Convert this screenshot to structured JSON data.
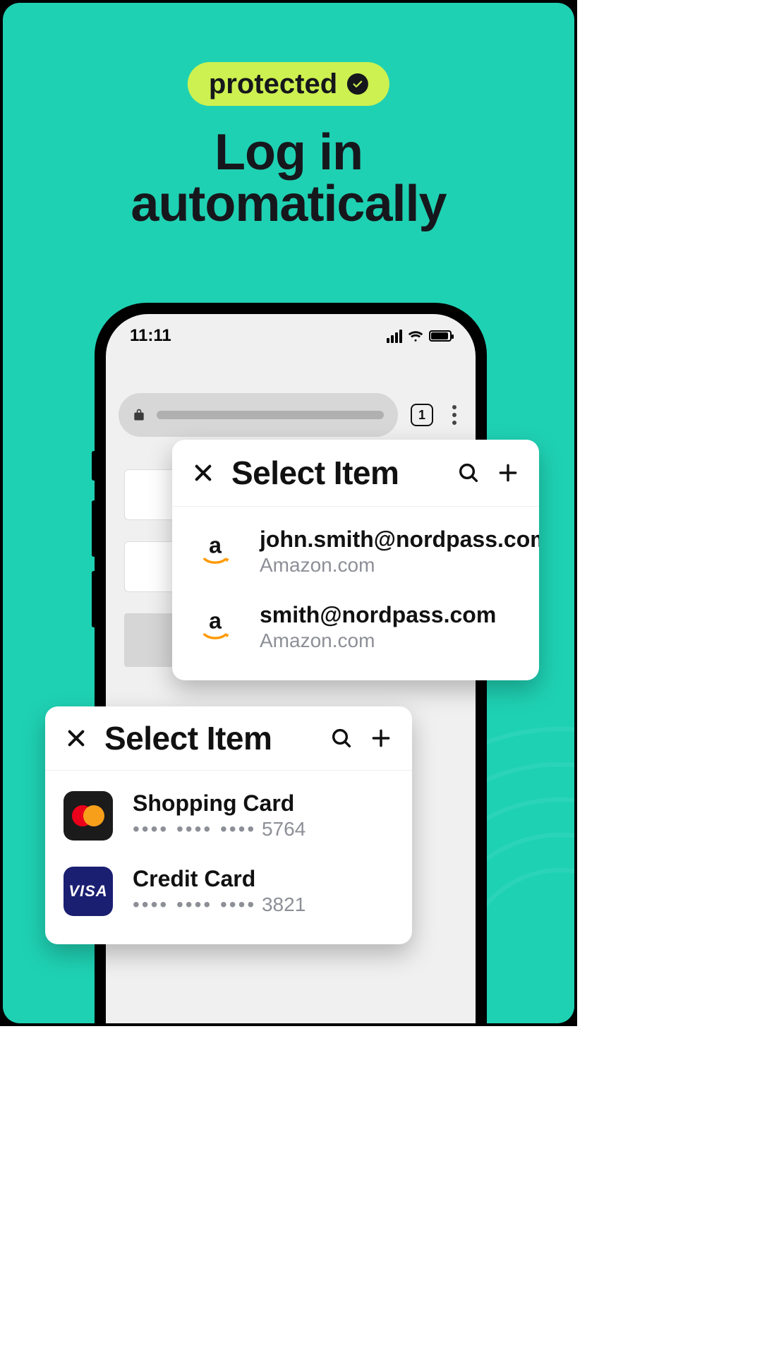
{
  "badge": {
    "label": "protected"
  },
  "headline": {
    "line1": "Log in",
    "line2": "automatically"
  },
  "phone": {
    "status_time": "11:11",
    "tab_count": "1"
  },
  "popup_accounts": {
    "title": "Select Item",
    "items": [
      {
        "title": "john.smith@nordpass.com",
        "subtitle": "Amazon.com",
        "icon": "amazon"
      },
      {
        "title": "smith@nordpass.com",
        "subtitle": "Amazon.com",
        "icon": "amazon"
      }
    ]
  },
  "popup_cards": {
    "title": "Select Item",
    "items": [
      {
        "title": "Shopping Card",
        "mask": "•••• •••• ••••",
        "last4": "5764",
        "icon": "mastercard"
      },
      {
        "title": "Credit Card",
        "mask": "•••• •••• ••••",
        "last4": "3821",
        "icon": "visa"
      }
    ]
  }
}
